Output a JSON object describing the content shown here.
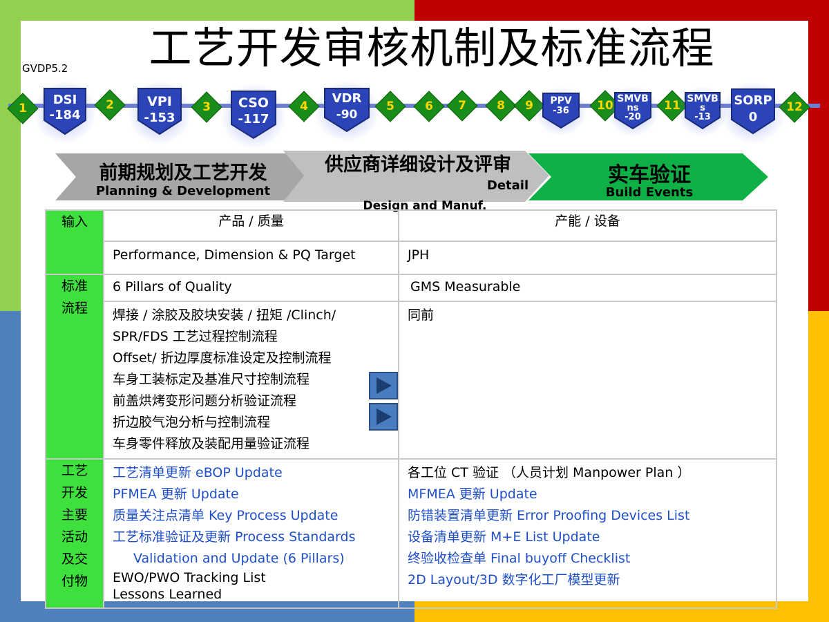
{
  "page": {
    "title": "工艺开发审核机制及标准流程",
    "version": "GVDP5.2"
  },
  "timeline": {
    "milestones": [
      "1",
      "2",
      "3",
      "4",
      "5",
      "6",
      "7",
      "8",
      "9",
      "10",
      "11",
      "12"
    ],
    "gates": [
      {
        "name": "DSI",
        "value": "-184"
      },
      {
        "name": "VPI",
        "value": "-153"
      },
      {
        "name": "CSO",
        "value": "-117"
      },
      {
        "name": "VDR",
        "value": "-90"
      },
      {
        "name": "PPV",
        "value": "-36"
      },
      {
        "name": "SMVBns",
        "line1": "SMVB",
        "line2": "ns",
        "value": "-20"
      },
      {
        "name": "SMVBs",
        "line1": "SMVB",
        "line2": "s",
        "value": "-13"
      },
      {
        "name": "SORP",
        "value": "0"
      }
    ]
  },
  "phases": [
    {
      "cn": "前期规划及工艺开发",
      "en": "Planning & Development"
    },
    {
      "cn": "供应商详细设计及评审",
      "en_line1": "Detail",
      "en_line2": "Design and Manuf."
    },
    {
      "cn": "实车验证",
      "en": "Build Events"
    }
  ],
  "table": {
    "col_headers": [
      "产品 / 质量",
      "产能 / 设备"
    ],
    "input": {
      "label": "输入",
      "product": "Performance, Dimension & PQ Target",
      "capacity": "JPH"
    },
    "standard": {
      "label_line1": "标准",
      "label_line2": "流程",
      "pillars_product": "6 Pillars of Quality",
      "pillars_capacity": "GMS Measurable",
      "product_lines": [
        "焊接 / 涂胶及胶块安装 / 扭矩 /Clinch/",
        "SPR/FDS 工艺过程控制流程",
        "Offset/ 折边厚度标准设定及控制流程",
        "车身工装标定及基准尺寸控制流程",
        "前盖烘烤变形问题分析验证流程",
        "折边胶气泡分析与控制流程",
        "车身零件释放及装配用量验证流程"
      ],
      "capacity_text": "同前"
    },
    "activities": {
      "label_lines": [
        "工艺",
        "开发",
        "主要",
        "活动",
        "及交",
        "付物"
      ],
      "product_lines": [
        {
          "text": "工艺清单更新   eBOP Update",
          "blue": true
        },
        {
          "text": "PFMEA 更新 Update",
          "blue": true
        },
        {
          "text": "质量关注点清单 Key Process Update",
          "blue": true
        },
        {
          "text": "工艺标准验证及更新   Process Standards",
          "blue": true
        },
        {
          "text": "Validation and Update (6 Pillars)",
          "blue": true,
          "indent": true
        },
        {
          "text": "EWO/PWO Tracking List",
          "blue": false
        },
        {
          "text": "Lessons Learned",
          "blue": false
        }
      ],
      "capacity_lines": [
        {
          "text": "各工位 CT 验证 （人员计划 Manpower Plan ）",
          "blue": false
        },
        {
          "text": "MFMEA 更新 Update",
          "blue": true
        },
        {
          "text": "防错装置清单更新   Error Proofing Devices List",
          "blue": true
        },
        {
          "text": "设备清单更新 M+E List Update",
          "blue": true
        },
        {
          "text": "终验收检查单   Final buyoff Checklist",
          "blue": true
        },
        {
          "text": "2D Layout/3D  数字化工厂模型更新",
          "blue": true
        }
      ]
    }
  },
  "colors": {
    "green_accent": "#3de03d",
    "milestone_green": "#1a8c1a",
    "milestone_text": "#ffd700",
    "gate_blue": "#2b44b8",
    "link_blue": "#1f4fc8"
  }
}
